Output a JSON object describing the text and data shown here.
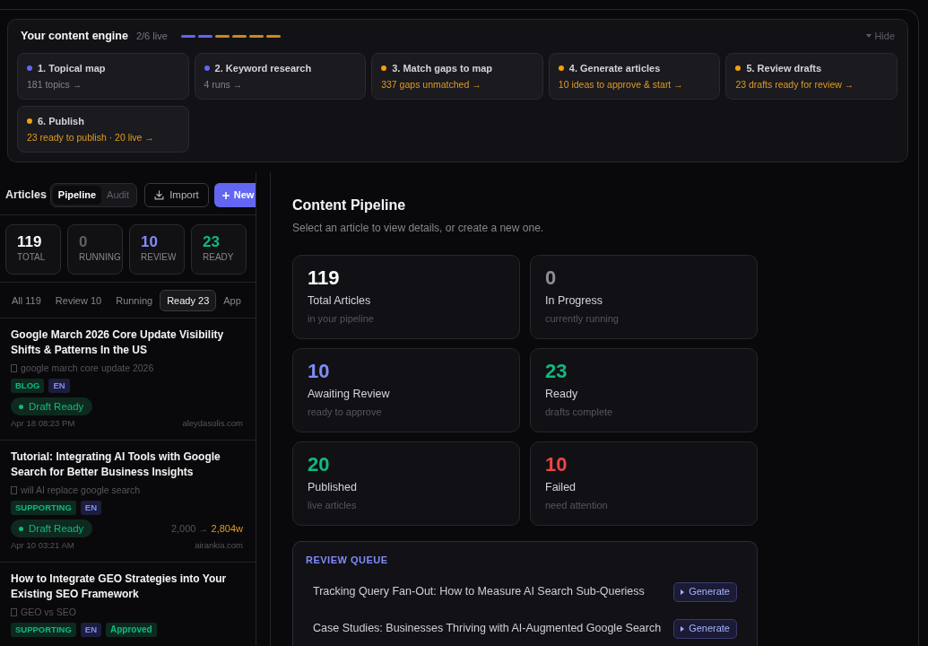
{
  "engine": {
    "title": "Your content engine",
    "live": "2/6 live",
    "hide_label": "Hide",
    "steps": [
      {
        "title": "1. Topical map",
        "detail": "181 topics →",
        "done": true
      },
      {
        "title": "2. Keyword research",
        "detail": "4 runs →",
        "done": true
      },
      {
        "title": "3. Match gaps to map",
        "detail": "337 gaps unmatched →",
        "done": false
      },
      {
        "title": "4. Generate articles",
        "detail": "10 ideas to approve & start →",
        "done": false
      },
      {
        "title": "5. Review drafts",
        "detail": "23 drafts ready for review →",
        "done": false
      },
      {
        "title": "6. Publish",
        "detail": "23 ready to publish · 20 live →",
        "done": false
      }
    ]
  },
  "articles_panel": {
    "title": "Articles",
    "view_toggle": [
      {
        "label": "Pipeline",
        "selected": true
      },
      {
        "label": "Audit",
        "selected": false
      }
    ],
    "import_label": "Import",
    "new_label": "New",
    "stats": [
      {
        "value": "119",
        "label": "TOTAL",
        "color": "#fafafa"
      },
      {
        "value": "0",
        "label": "RUNNING",
        "color": "#5f5f66"
      },
      {
        "value": "10",
        "label": "REVIEW",
        "color": "#818cf8"
      },
      {
        "value": "23",
        "label": "READY",
        "color": "#10b981"
      }
    ],
    "filters": [
      {
        "label": "All 119",
        "selected": false
      },
      {
        "label": "Review 10",
        "selected": false
      },
      {
        "label": "Running",
        "selected": false
      },
      {
        "label": "Ready 23",
        "selected": true
      },
      {
        "label": "App",
        "selected": false
      }
    ],
    "articles": [
      {
        "title": "Google March 2026 Core Update Visibility Shifts & Patterns In the US",
        "keyword": "google march core update 2026",
        "tags": [
          {
            "text": "BLOG",
            "kind": "category"
          },
          {
            "text": "EN",
            "kind": "language"
          }
        ],
        "status": "Draft Ready",
        "date": "Apr 18 08:23 PM",
        "domain": "aleydasolis.com"
      },
      {
        "title": "Tutorial: Integrating AI Tools with Google Search for Better Business Insights",
        "keyword": "will AI replace google search",
        "tags": [
          {
            "text": "SUPPORTING",
            "kind": "category"
          },
          {
            "text": "EN",
            "kind": "language"
          }
        ],
        "status": "Draft Ready",
        "word_count": {
          "target": "2,000 →",
          "actual": "2,804w"
        },
        "date": "Apr 10 03:21 AM",
        "domain": "airankia.com"
      },
      {
        "title": "How to Integrate GEO Strategies into Your Existing SEO Framework",
        "keyword": "GEO vs SEO",
        "tags": [
          {
            "text": "SUPPORTING",
            "kind": "category"
          },
          {
            "text": "EN",
            "kind": "language"
          },
          {
            "text": "Approved",
            "kind": "approval"
          }
        ]
      }
    ]
  },
  "main": {
    "title": "Content Pipeline",
    "subtitle": "Select an article to view details, or create a new one.",
    "stats": [
      {
        "value": "119",
        "label": "Total Articles",
        "caption": "in your pipeline",
        "color": "#fafafa"
      },
      {
        "value": "0",
        "label": "In Progress",
        "caption": "currently running",
        "color": "#8e8e96"
      },
      {
        "value": "10",
        "label": "Awaiting Review",
        "caption": "ready to approve",
        "color": "#818cf8"
      },
      {
        "value": "23",
        "label": "Ready",
        "caption": "drafts complete",
        "color": "#10b981"
      },
      {
        "value": "20",
        "label": "Published",
        "caption": "live articles",
        "color": "#10b981"
      },
      {
        "value": "10",
        "label": "Failed",
        "caption": "need attention",
        "color": "#ef4444"
      }
    ],
    "review_queue": {
      "title": "REVIEW QUEUE",
      "items": [
        {
          "title": "Tracking Query Fan-Out: How to Measure AI Search Sub-Queriess",
          "action": "Generate"
        },
        {
          "title": "Case Studies: Businesses Thriving with AI-Augmented Google Search",
          "action": "Generate"
        }
      ]
    }
  }
}
